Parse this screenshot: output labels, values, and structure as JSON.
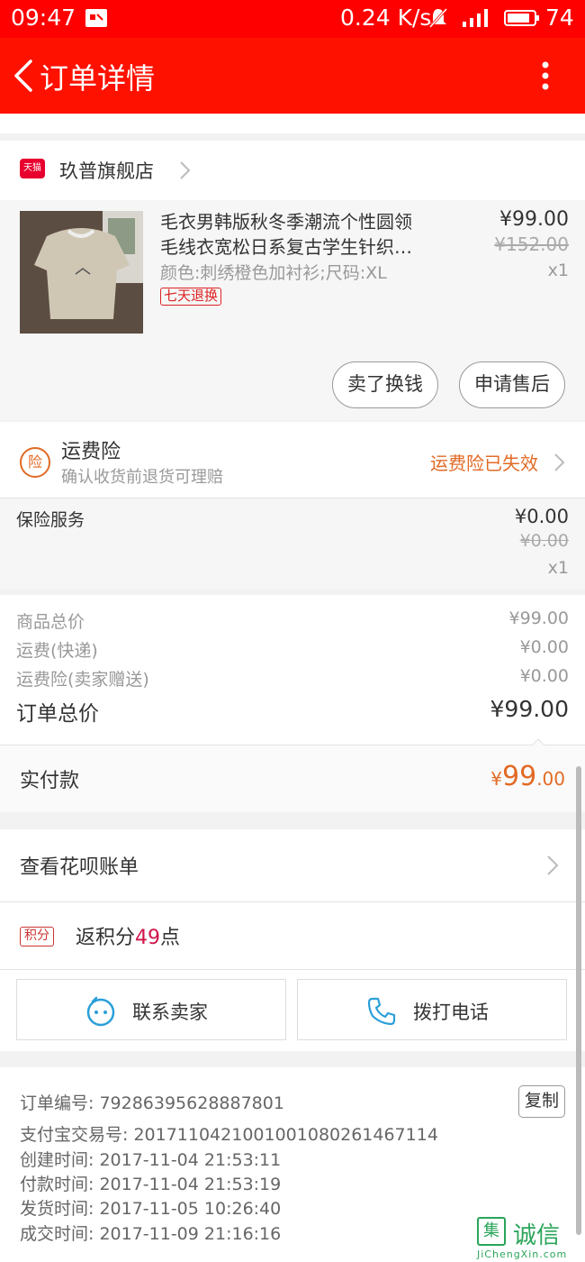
{
  "status_bar": {
    "time": "09:47",
    "net_speed": "0.24 K/s",
    "battery": "74"
  },
  "nav": {
    "title": "订单详情"
  },
  "shop": {
    "badge": "天猫",
    "name": "玖普旗舰店"
  },
  "product": {
    "title_line1": "毛衣男韩版秋冬季潮流个性圆领",
    "title_line2": "毛线衣宽松日系复古学生针织…",
    "sku": "颜色:刺绣橙色加衬衫;尺码:XL",
    "tag": "七天退换",
    "price": "¥99.00",
    "original_price": "¥152.00",
    "qty": "x1",
    "buttons": [
      "卖了换钱",
      "申请售后"
    ]
  },
  "shipping_insurance": {
    "icon_text": "险",
    "title": "运费险",
    "subtitle": "确认收货前退货可理赔",
    "status": "运费险已失效"
  },
  "insurance_service": {
    "label": "保险服务",
    "price": "¥0.00",
    "original_price": "¥0.00",
    "qty": "x1"
  },
  "summary": {
    "rows": [
      {
        "label": "商品总价",
        "value": "¥99.00"
      },
      {
        "label": "运费(快递)",
        "value": "¥0.00"
      },
      {
        "label": "运费险(卖家赠送)",
        "value": "¥0.00"
      }
    ],
    "total_label": "订单总价",
    "total_value": "¥99.00"
  },
  "paid": {
    "label": "实付款",
    "currency": "¥",
    "int": "99",
    "dec": ".00"
  },
  "huabei": {
    "label": "查看花呗账单"
  },
  "points": {
    "badge": "积分",
    "prefix": "返积分",
    "num": "49",
    "suffix": "点"
  },
  "contact": {
    "seller": "联系卖家",
    "call": "拨打电话"
  },
  "order_info": {
    "order_no": "订单编号: 79286395628887801",
    "copy": "复制",
    "alipay_no": "支付宝交易号: 2017110421001001080261467114",
    "created": "创建时间: 2017-11-04  21:53:11",
    "paid": "付款时间: 2017-11-04  21:53:19",
    "shipped": "发货时间: 2017-11-05  10:26:40",
    "completed": "成交时间: 2017-11-09  21:16:16"
  },
  "watermark": {
    "box": "集",
    "cn": "诚信",
    "en": "JiChengXin.com"
  },
  "colors": {
    "nav_red": "#ff1100",
    "accent_orange": "#e26a25",
    "points_pink": "#d0144a"
  }
}
